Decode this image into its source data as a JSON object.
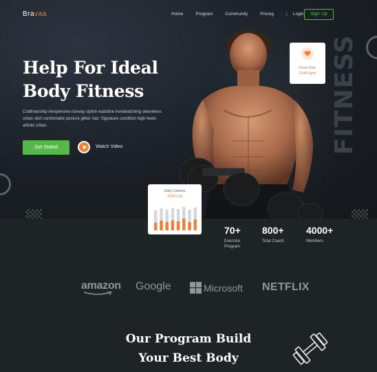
{
  "brand": {
    "name_a": "Bra",
    "name_b": "vaa"
  },
  "nav": {
    "items": [
      "Home",
      "Program",
      "Community",
      "Pricing"
    ],
    "separator": "|",
    "login": "Login",
    "signup": "Sign Up"
  },
  "hero": {
    "title_line1": "Help For Ideal",
    "title_line2": "Body Fitness",
    "description": "Craftmanship inexpensive runway stylish waistline trendwatching sleeveless urban skirt comfortable posture glitter hair. Signature condition high heels artistic urban.",
    "cta_label": "Get Stated",
    "watch_label": "Watch Video",
    "vertical_text": "FITNESS"
  },
  "heart_card": {
    "label": "Heart Rate",
    "value": "2246 bpm"
  },
  "calories_card": {
    "title": "Daily Calories",
    "value": "1020 Cal",
    "levels": [
      0.55,
      0.7,
      0.6,
      0.72,
      0.65,
      0.85,
      0.6,
      0.78
    ]
  },
  "stats": [
    {
      "value": "70+",
      "label_line1": "Exercise",
      "label_line2": "Program"
    },
    {
      "value": "800+",
      "label_line1": "Total Coach",
      "label_line2": ""
    },
    {
      "value": "4000+",
      "label_line1": "Members",
      "label_line2": ""
    }
  ],
  "partners": [
    "amazon",
    "Google",
    "Microsoft",
    "NETFLIX"
  ],
  "program": {
    "title_line1": "Our Program Build",
    "title_line2": "Your Best Body"
  },
  "colors": {
    "accent_green": "#55b848",
    "accent_orange": "#e8823e",
    "background": "#1e2326"
  }
}
